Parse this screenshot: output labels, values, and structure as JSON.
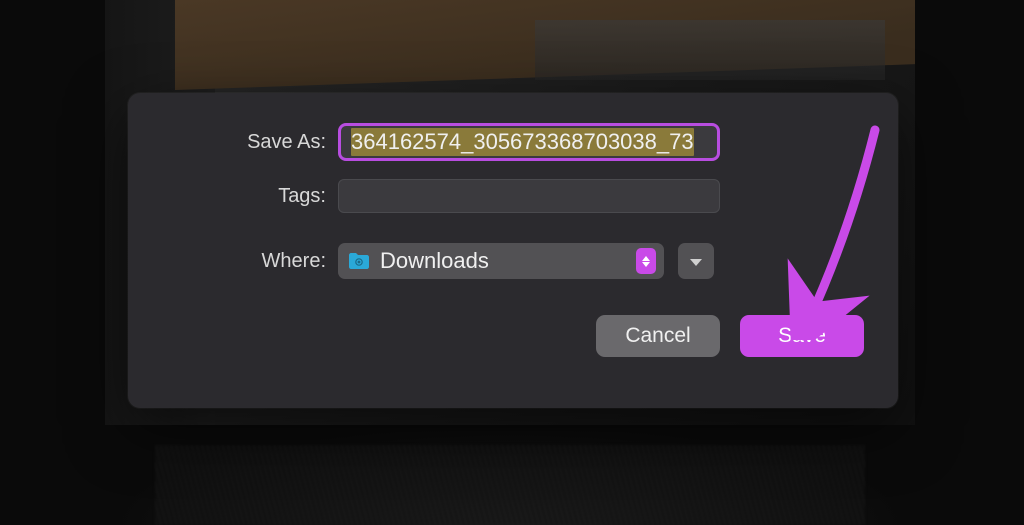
{
  "dialog": {
    "saveas_label": "Save As:",
    "saveas_value": "364162574_305673368703038_73",
    "tags_label": "Tags:",
    "tags_value": "",
    "where_label": "Where:",
    "where_value": "Downloads",
    "cancel_label": "Cancel",
    "save_label": "Save"
  },
  "colors": {
    "accent": "#c94ae8",
    "dialog_bg": "#2b2a2e",
    "input_bg": "#3b3a3e",
    "button_secondary": "#6a696c"
  }
}
